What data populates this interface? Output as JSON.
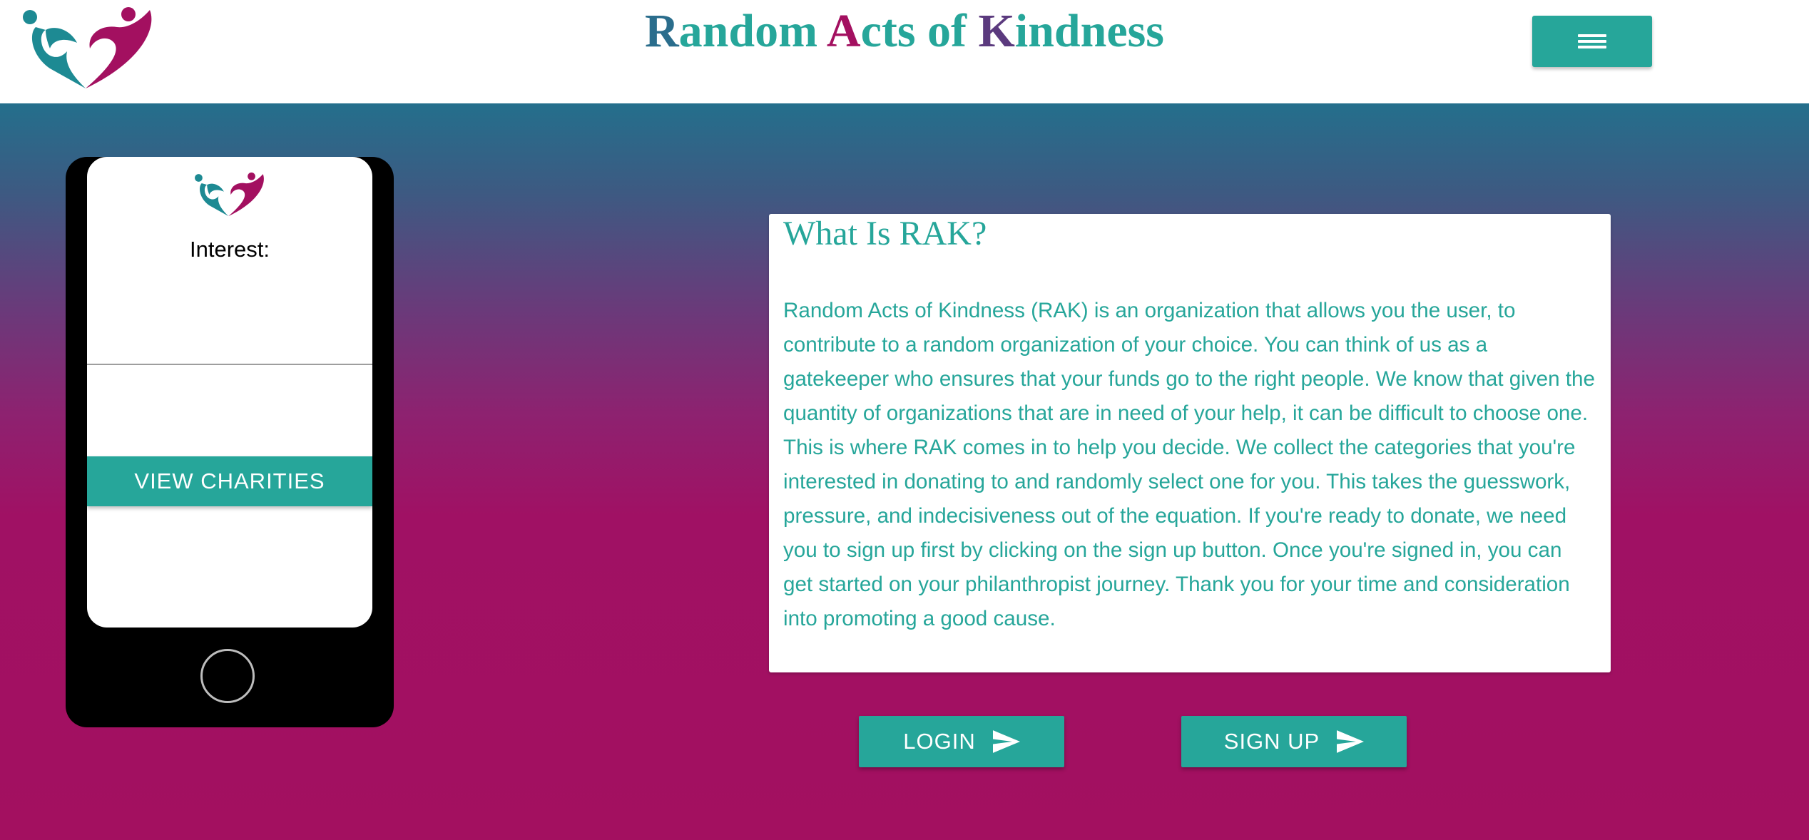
{
  "header": {
    "title_parts": {
      "r": "R",
      "andom": "andom ",
      "a": "A",
      "cts_of": "cts of ",
      "k": "K",
      "indness": "indness"
    },
    "menu_icon": "hamburger-menu-icon"
  },
  "phone": {
    "interest_label": "Interest:",
    "interest_value": "",
    "view_charities_label": "VIEW CHARITIES"
  },
  "about": {
    "title": "What Is RAK?",
    "body": "Random Acts of Kindness (RAK) is an organization that allows you the user, to contribute to a random organization of your choice. You can think of us as a gatekeeper who ensures that your funds go to the right people. We know that given the quantity of organizations that are in need of your help, it can be difficult to choose one. This is where RAK comes in to help you decide. We collect the categories that you're interested in donating to and randomly select one for you. This takes the guesswork, pressure, and indecisiveness out of the equation. If you're ready to donate, we need you to sign up first by clicking on the sign up button. Once you're signed in, you can get started on your philanthropist journey. Thank you for your time and consideration into promoting a good cause."
  },
  "actions": {
    "login_label": "LOGIN",
    "signup_label": "SIGN UP",
    "icon": "send-icon"
  },
  "colors": {
    "teal": "#26a69a",
    "magenta": "#a31060",
    "blue": "#2a6d8c",
    "purple": "#5b3a7e"
  }
}
